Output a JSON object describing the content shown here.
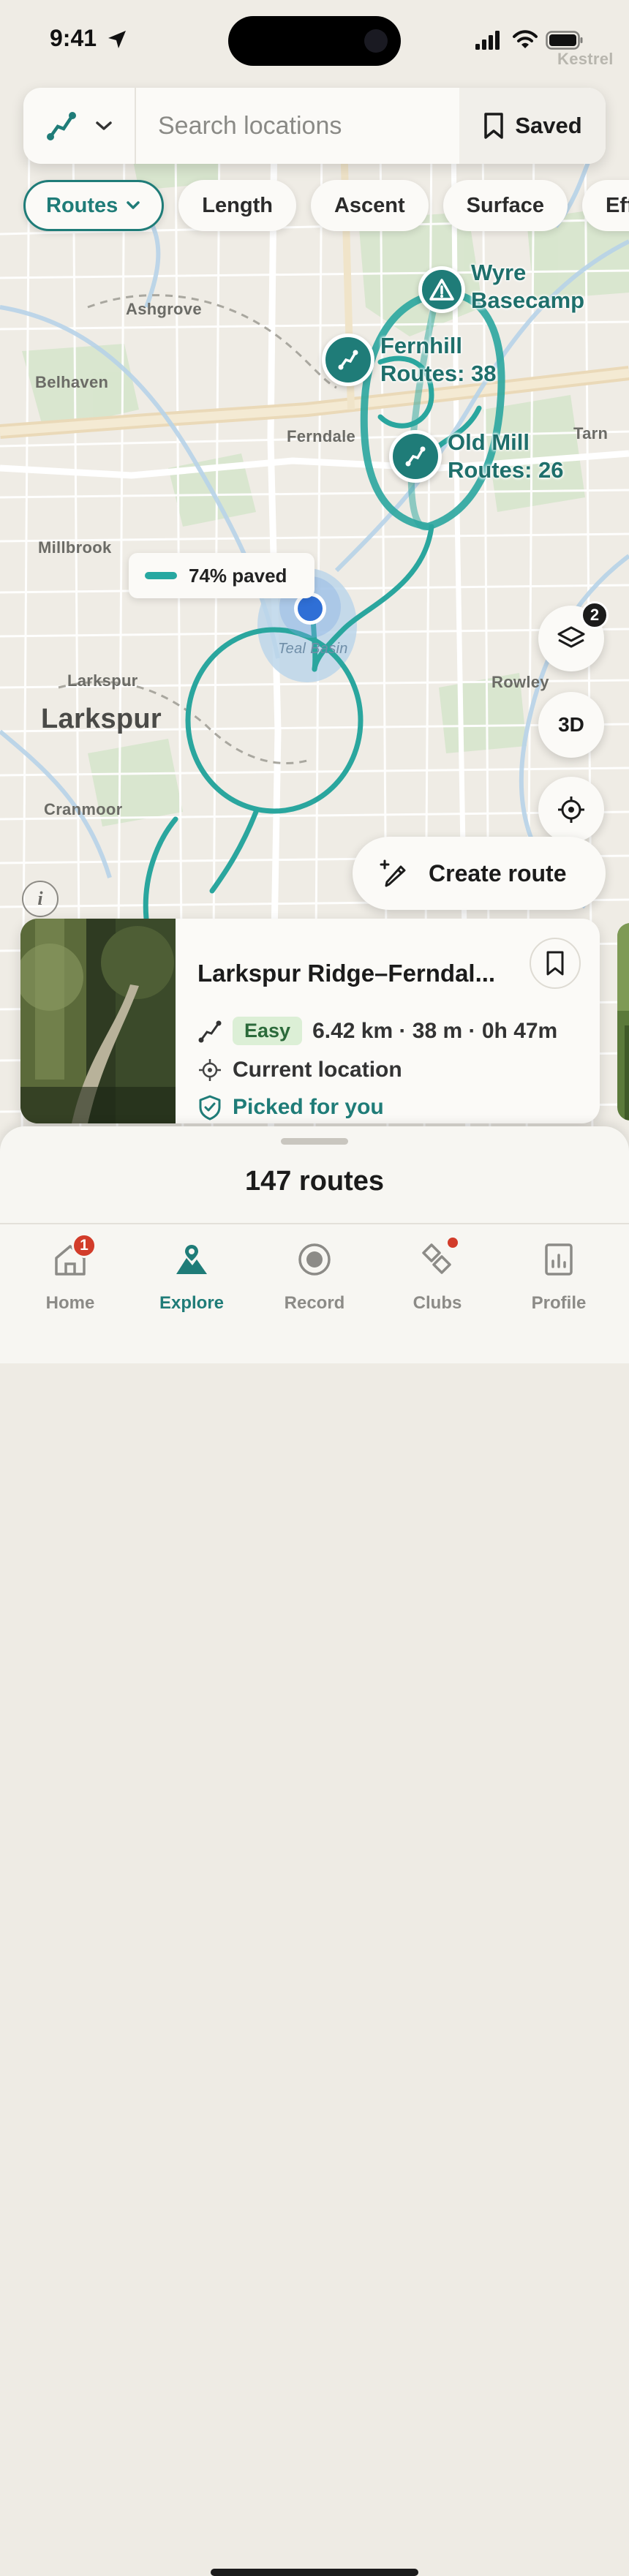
{
  "status": {
    "time": "9:41"
  },
  "search": {
    "placeholder": "Search locations",
    "saved_label": "Saved"
  },
  "filters": [
    "Routes",
    "Length",
    "Ascent",
    "Surface",
    "Eff"
  ],
  "map": {
    "watermark": "Kestrel",
    "places": [
      "Ashgrove",
      "Belhaven",
      "Ferndale",
      "Tarn",
      "Millbrook",
      "Larkspur",
      "Rowley",
      "Cranmoor"
    ],
    "area_label": "Larkspur",
    "water_label": "Teal Basin",
    "markers": [
      {
        "name": "Wyre Basecamp",
        "line1": "Wyre",
        "line2": "Basecamp",
        "icon": "warning-icon"
      },
      {
        "name": "Fernhill",
        "line1": "Fernhill",
        "line2": "Routes: 38",
        "icon": "route-icon"
      },
      {
        "name": "Old Mill",
        "line1": "Old Mill",
        "line2": "Routes: 26",
        "icon": "route-icon"
      }
    ],
    "surface_pill": "74% paved",
    "layers_badge": "2",
    "btn_3d": "3D",
    "info_label": "i",
    "create_route": "Create route",
    "accent": "#1f7c78",
    "route_color": "#2aa69e"
  },
  "card": {
    "title": "Larkspur Ridge–Ferndal...",
    "difficulty": "Easy",
    "stats": "6.42 km · 38 m · 0h 47m",
    "start": "Current location",
    "tag": "Picked for you"
  },
  "sheet": {
    "count": "147 routes"
  },
  "tabs": [
    {
      "label": "Home",
      "badge": "1"
    },
    {
      "label": "Explore"
    },
    {
      "label": "Record"
    },
    {
      "label": "Clubs"
    },
    {
      "label": "Profile"
    }
  ]
}
